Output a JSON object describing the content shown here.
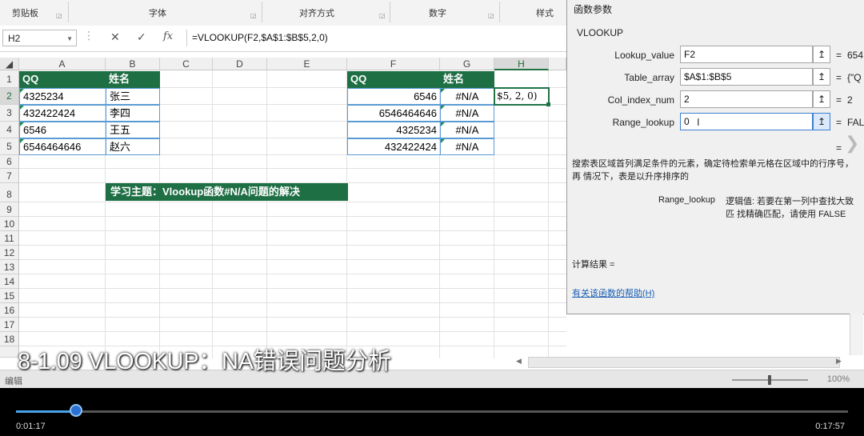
{
  "ribbon": {
    "groups": [
      "剪贴板",
      "字体",
      "对齐方式",
      "数字",
      "样式"
    ]
  },
  "formula_bar": {
    "name_box": "H2",
    "cancel_icon": "✕",
    "enter_icon": "✓",
    "fx_label": "fx",
    "formula": "=VLOOKUP(F2,$A$1:$B$5,2,0)"
  },
  "columns": [
    "A",
    "B",
    "C",
    "D",
    "E",
    "F",
    "G",
    "H"
  ],
  "rows": [
    "1",
    "2",
    "3",
    "4",
    "5",
    "6",
    "7",
    "8",
    "9",
    "10",
    "11",
    "12",
    "13",
    "14",
    "15",
    "16",
    "17",
    "18"
  ],
  "table_left": {
    "headers": [
      "QQ",
      "姓名"
    ],
    "rows": [
      [
        "4325234",
        "张三"
      ],
      [
        "432422424",
        "李四"
      ],
      [
        "6546",
        "王五"
      ],
      [
        "6546464646",
        "赵六"
      ]
    ]
  },
  "table_right": {
    "headers": [
      "QQ",
      "姓名"
    ],
    "rows": [
      [
        "6546",
        "#N/A"
      ],
      [
        "6546464646",
        "#N/A"
      ],
      [
        "4325234",
        "#N/A"
      ],
      [
        "432422424",
        "#N/A"
      ]
    ]
  },
  "h2_edit_text": "$5, 2, 0)",
  "banner": "学习主题：Vlookup函数#N/A问题的解决",
  "dialog": {
    "title": "函数参数",
    "function_name": "VLOOKUP",
    "args": [
      {
        "label": "Lookup_value",
        "value": "F2",
        "result": "654"
      },
      {
        "label": "Table_array",
        "value": "$A$1:$B$5",
        "result": "{\"Q"
      },
      {
        "label": "Col_index_num",
        "value": "2",
        "result": "2"
      },
      {
        "label": "Range_lookup",
        "value": "0",
        "result": "FAL"
      }
    ],
    "collapse_icon": "↥",
    "equals": "=",
    "description": "搜索表区域首列满足条件的元素，确定待检索单元格在区域中的行序号，再 情况下，表是以升序排序的",
    "param_label": "Range_lookup",
    "param_desc": "逻辑值: 若要在第一列中查找大致匹 找精确匹配，请使用 FALSE",
    "calc_result": "计算结果 =",
    "help_link": "有关该函数的帮助(H)"
  },
  "status": {
    "left": "编辑",
    "right": "100%"
  },
  "caption": "8-1.09 VLOOKUP：NA错误问题分析",
  "player": {
    "current_time": "0:01:17",
    "total_time": "0:17:57",
    "progress": 0.072,
    "accent": "#2a6fd1"
  }
}
